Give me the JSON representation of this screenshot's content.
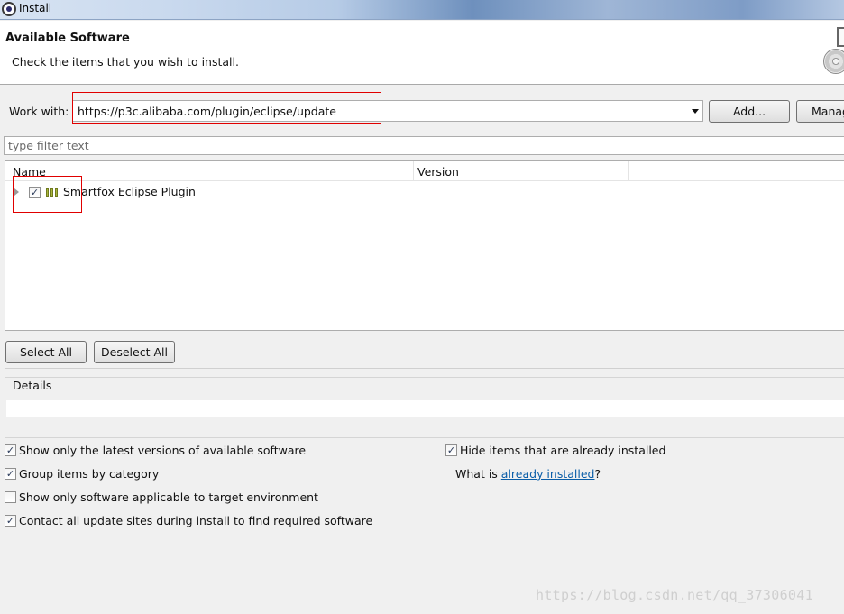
{
  "window": {
    "title": "Install"
  },
  "header": {
    "title": "Available Software",
    "subtitle": "Check the items that you wish to install."
  },
  "work_with": {
    "label": "Work with:",
    "value": "https://p3c.alibaba.com/plugin/eclipse/update",
    "add_label": "Add...",
    "manage_label": "Manag"
  },
  "filter": {
    "placeholder": "type filter text"
  },
  "table": {
    "columns": [
      "Name",
      "Version"
    ],
    "rows": [
      {
        "name": "Smartfox Eclipse Plugin",
        "version": "",
        "checked": true
      }
    ]
  },
  "buttons": {
    "select_all": "Select All",
    "deselect_all": "Deselect All"
  },
  "details": {
    "label": "Details"
  },
  "options": {
    "latest_versions": {
      "label": "Show only the latest versions of available software",
      "checked": true
    },
    "group_by_category": {
      "label": "Group items by category",
      "checked": true
    },
    "target_env": {
      "label": "Show only software applicable to target environment",
      "checked": false
    },
    "contact_sites": {
      "label": "Contact all update sites during install to find required software",
      "checked": true
    },
    "hide_installed": {
      "label": "Hide items that are already installed",
      "checked": true
    },
    "what_is_prefix": "What is ",
    "what_is_link": "already installed",
    "what_is_suffix": "?"
  },
  "watermark": "https://blog.csdn.net/qq_37306041",
  "colors": {
    "highlight_box": "#e00000",
    "link": "#0b5ea8"
  }
}
